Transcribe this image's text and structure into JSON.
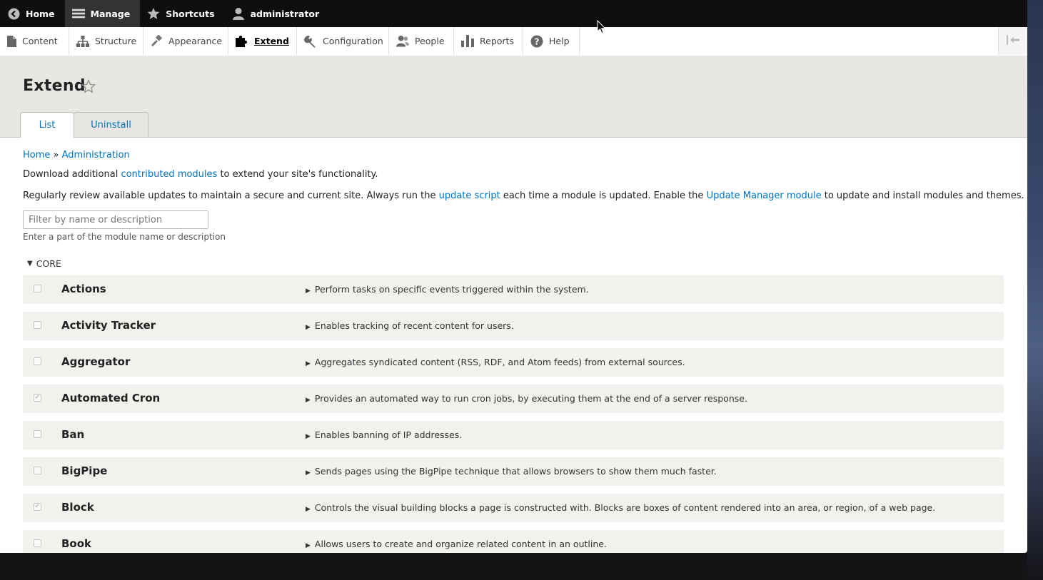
{
  "toolbar": {
    "home": "Home",
    "manage": "Manage",
    "shortcuts": "Shortcuts",
    "user": "administrator"
  },
  "tray": {
    "items": [
      {
        "label": "Content",
        "icon": "file-icon"
      },
      {
        "label": "Structure",
        "icon": "structure-icon"
      },
      {
        "label": "Appearance",
        "icon": "paint-icon"
      },
      {
        "label": "Extend",
        "icon": "puzzle-icon"
      },
      {
        "label": "Configuration",
        "icon": "wrench-icon"
      },
      {
        "label": "People",
        "icon": "people-icon"
      },
      {
        "label": "Reports",
        "icon": "bar-chart-icon"
      },
      {
        "label": "Help",
        "icon": "help-icon"
      }
    ]
  },
  "header": {
    "title": "Extend",
    "tabs": [
      "List",
      "Uninstall"
    ]
  },
  "breadcrumb": {
    "home": "Home",
    "sep": "»",
    "admin": "Administration"
  },
  "intro": {
    "p1_before": "Download additional ",
    "p1_link": "contributed modules",
    "p1_after": " to extend your site's functionality.",
    "p2_before": "Regularly review available updates to maintain a secure and current site. Always run the ",
    "p2_link1": "update script",
    "p2_middle": " each time a module is updated. Enable the ",
    "p2_link2": "Update Manager module",
    "p2_after": " to update and install modules and themes."
  },
  "filter": {
    "placeholder": "Filter by name or description",
    "help": "Enter a part of the module name or description"
  },
  "group": {
    "label": "CORE"
  },
  "modules": [
    {
      "name": "Actions",
      "desc": "Perform tasks on specific events triggered within the system.",
      "checked": false
    },
    {
      "name": "Activity Tracker",
      "desc": "Enables tracking of recent content for users.",
      "checked": false
    },
    {
      "name": "Aggregator",
      "desc": "Aggregates syndicated content (RSS, RDF, and Atom feeds) from external sources.",
      "checked": false
    },
    {
      "name": "Automated Cron",
      "desc": "Provides an automated way to run cron jobs, by executing them at the end of a server response.",
      "checked": true
    },
    {
      "name": "Ban",
      "desc": "Enables banning of IP addresses.",
      "checked": false
    },
    {
      "name": "BigPipe",
      "desc": "Sends pages using the BigPipe technique that allows browsers to show them much faster.",
      "checked": false
    },
    {
      "name": "Block",
      "desc": "Controls the visual building blocks a page is constructed with. Blocks are boxes of content rendered into an area, or region, of a web page.",
      "checked": true
    },
    {
      "name": "Book",
      "desc": "Allows users to create and organize related content in an outline.",
      "checked": false
    }
  ],
  "colors": {
    "link": "#0074bd",
    "toolbar_bg": "#0f0f0f",
    "header_bg": "#e8e7e3",
    "row_bg": "#f2f1ed"
  }
}
